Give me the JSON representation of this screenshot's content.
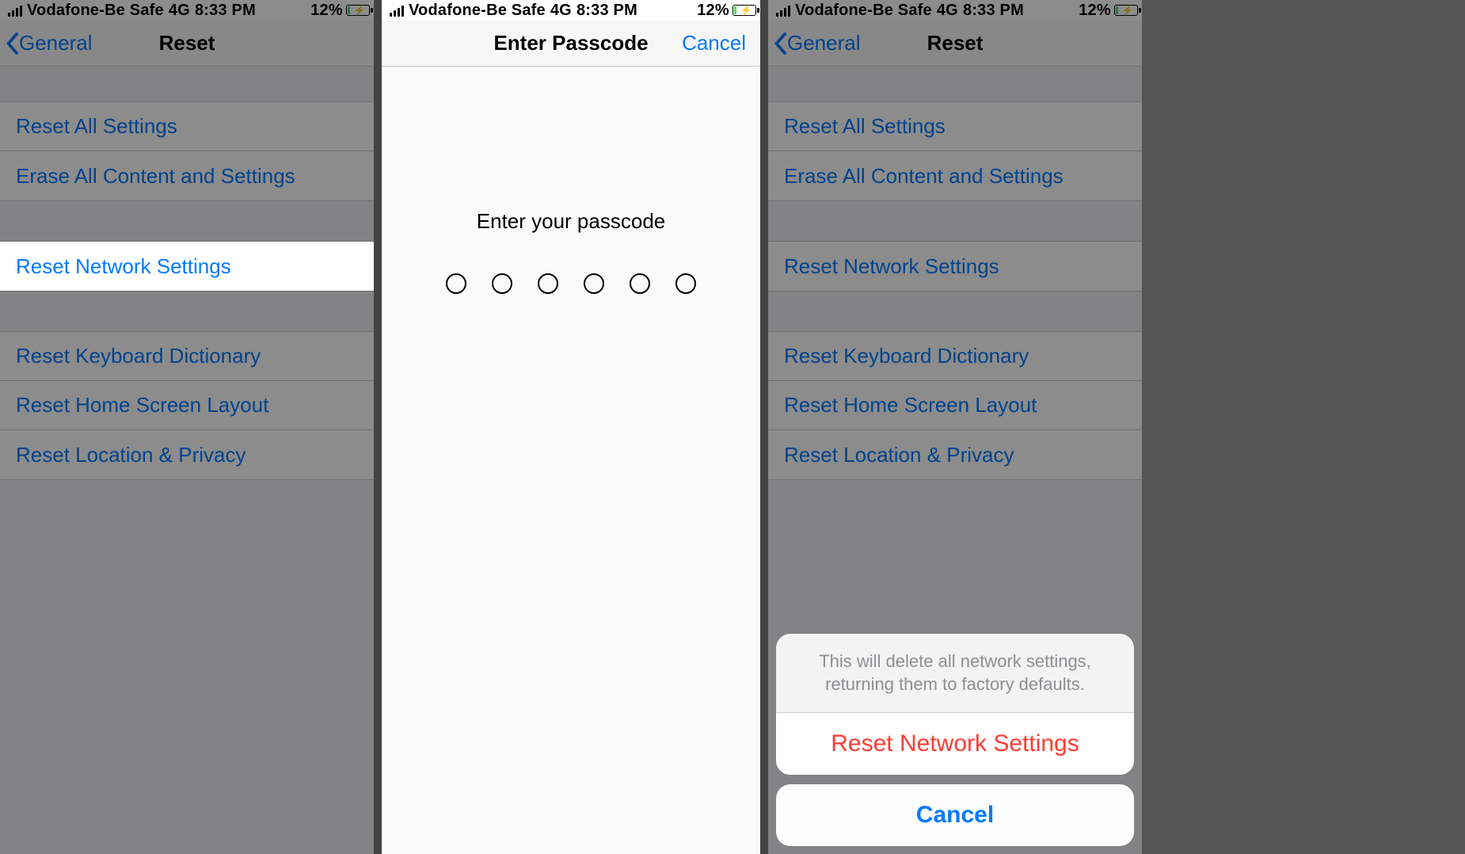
{
  "statusBar": {
    "carrier": "Vodafone-Be Safe",
    "network": "4G",
    "time": "8:33 PM",
    "batteryPercent": "12%"
  },
  "screen1": {
    "back": "General",
    "title": "Reset",
    "group1": {
      "resetAll": "Reset All Settings",
      "eraseAll": "Erase All Content and Settings"
    },
    "group2": {
      "resetNetwork": "Reset Network Settings"
    },
    "group3": {
      "resetKeyboard": "Reset Keyboard Dictionary",
      "resetHome": "Reset Home Screen Layout",
      "resetLocation": "Reset Location & Privacy"
    }
  },
  "screen2": {
    "title": "Enter Passcode",
    "cancel": "Cancel",
    "prompt": "Enter your passcode"
  },
  "screen3": {
    "back": "General",
    "title": "Reset",
    "group1": {
      "resetAll": "Reset All Settings",
      "eraseAll": "Erase All Content and Settings"
    },
    "group2": {
      "resetNetwork": "Reset Network Settings"
    },
    "group3": {
      "resetKeyboard": "Reset Keyboard Dictionary",
      "resetHome": "Reset Home Screen Layout",
      "resetLocation": "Reset Location & Privacy"
    },
    "sheet": {
      "message": "This will delete all network settings, returning them to factory defaults.",
      "confirm": "Reset Network Settings",
      "cancel": "Cancel"
    }
  }
}
